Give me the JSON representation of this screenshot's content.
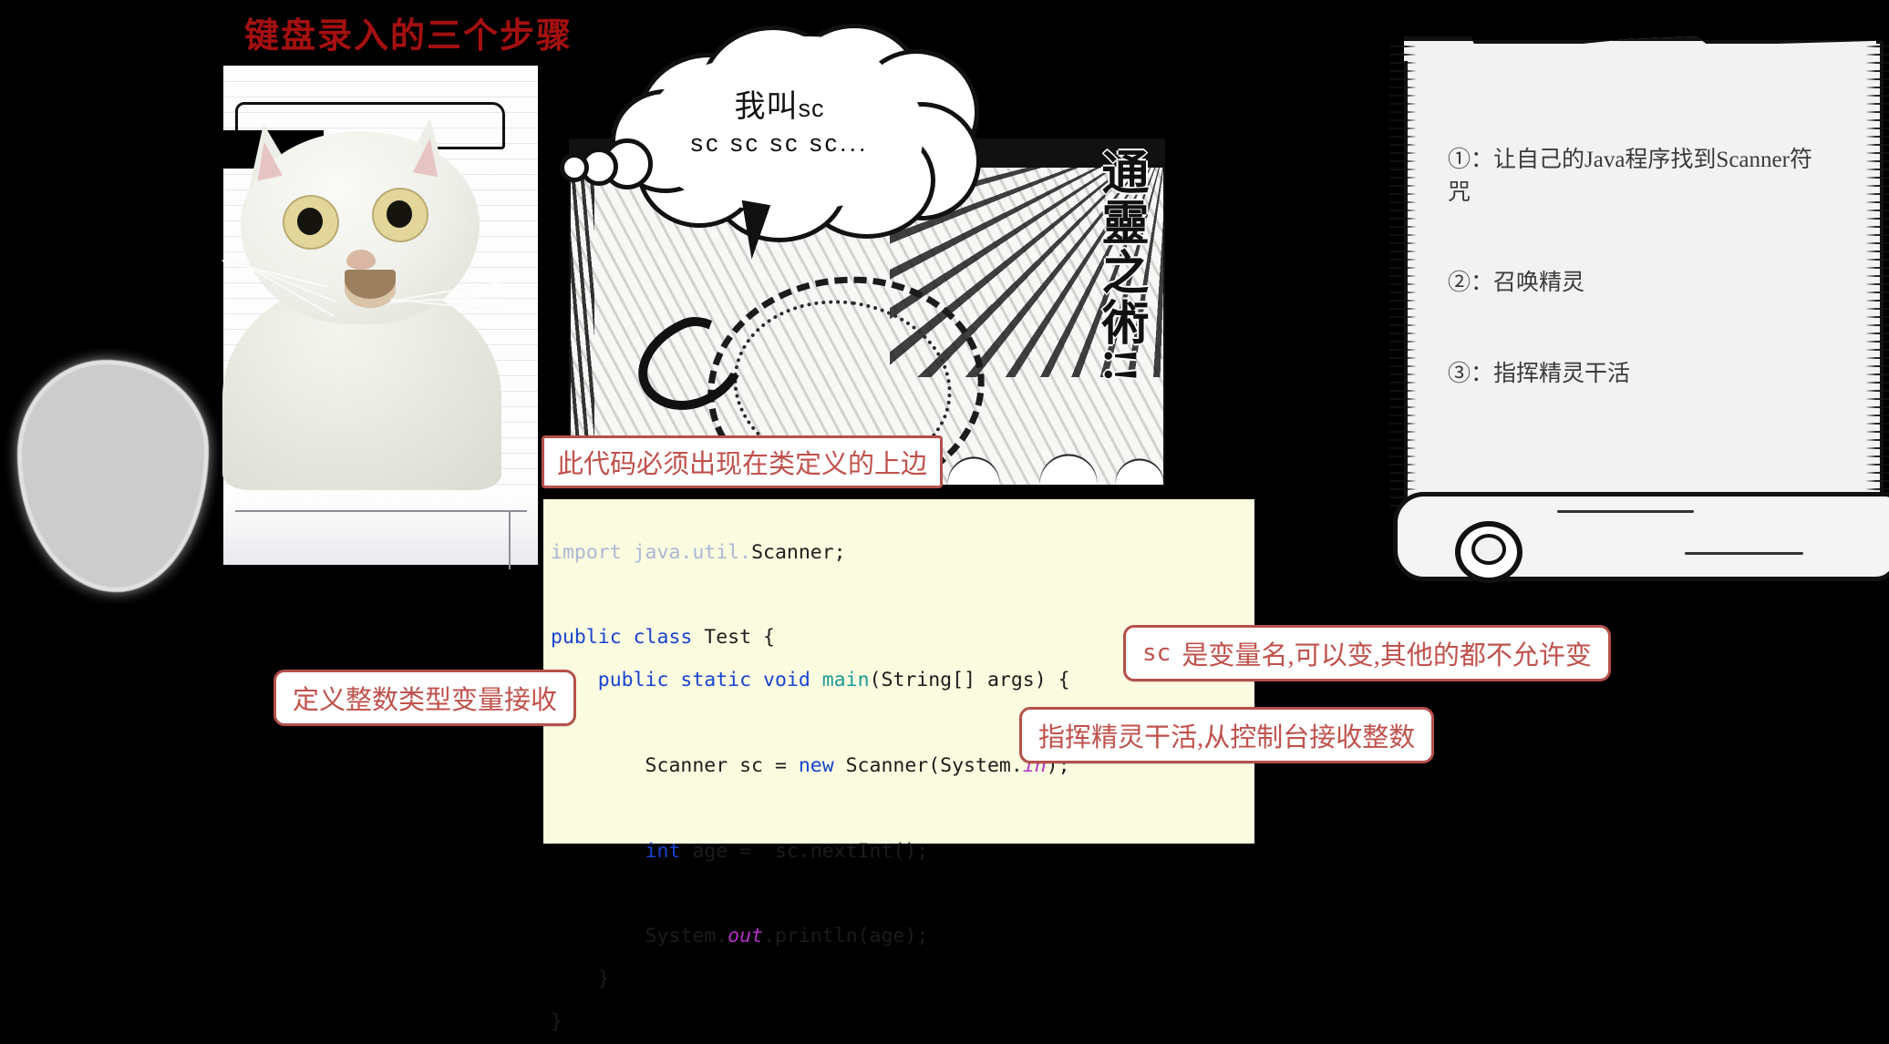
{
  "title": "键盘录入的三个步骤",
  "colors": {
    "title_red": "#A41010",
    "callout_border": "#B5504B",
    "callout_text": "#C0514C",
    "code_bg": "#fbfbdf",
    "keyword_blue": "#1743d1",
    "keyword_dim": "#a9b8d6",
    "method_teal": "#1c9b96",
    "field_purple": "#b42ec6",
    "scroll_bg": "#f2f2f2",
    "background": "#000000"
  },
  "thought_bubble": {
    "name": "speech-bubble",
    "line1_cn": "我叫",
    "line1_en": "sc",
    "line2": "sc sc sc sc..."
  },
  "manga_panel": {
    "vertical_text": "通靈之術!!",
    "alt": "manga summoning circle panel"
  },
  "cat": {
    "alt": "surprised white cat meme"
  },
  "scroll": {
    "name": "steps-scroll",
    "items": [
      "①：让自己的Java程序找到Scanner符咒",
      "②：召唤精灵",
      "③：指挥精灵干活"
    ]
  },
  "code": {
    "language": "java",
    "lines": [
      {
        "tokens": [
          {
            "t": "import",
            "c": "kw-dim"
          },
          {
            "t": " java.util.",
            "c": "kw-dim"
          },
          {
            "t": "Scanner;",
            "c": ""
          }
        ]
      },
      {
        "tokens": []
      },
      {
        "tokens": [
          {
            "t": "public class ",
            "c": "kw"
          },
          {
            "t": "Test {",
            "c": ""
          }
        ]
      },
      {
        "tokens": [
          {
            "t": "    ",
            "c": ""
          },
          {
            "t": "public static void ",
            "c": "kw"
          },
          {
            "t": "main",
            "c": "fn"
          },
          {
            "t": "(String[] args) {",
            "c": ""
          }
        ]
      },
      {
        "tokens": []
      },
      {
        "tokens": [
          {
            "t": "        Scanner sc = ",
            "c": ""
          },
          {
            "t": "new",
            "c": "kw"
          },
          {
            "t": " Scanner(System.",
            "c": ""
          },
          {
            "t": "in",
            "c": "fld"
          },
          {
            "t": ");",
            "c": ""
          }
        ]
      },
      {
        "tokens": []
      },
      {
        "tokens": [
          {
            "t": "        ",
            "c": ""
          },
          {
            "t": "int",
            "c": "kw"
          },
          {
            "t": " age =  sc.nextInt();",
            "c": ""
          }
        ]
      },
      {
        "tokens": []
      },
      {
        "tokens": [
          {
            "t": "        System.",
            "c": ""
          },
          {
            "t": "out",
            "c": "fld"
          },
          {
            "t": ".println(age);",
            "c": ""
          }
        ]
      },
      {
        "tokens": [
          {
            "t": "    }",
            "c": ""
          }
        ]
      },
      {
        "tokens": [
          {
            "t": "}",
            "c": ""
          }
        ]
      }
    ]
  },
  "callouts": {
    "import_note": "此代码必须出现在类定义的上边",
    "define_var": "定义整数类型变量接收",
    "sc_name_mono": "sc",
    "sc_name": "是变量名,可以变,其他的都不允许变",
    "console_note": "指挥精灵干活,从控制台接收整数"
  }
}
